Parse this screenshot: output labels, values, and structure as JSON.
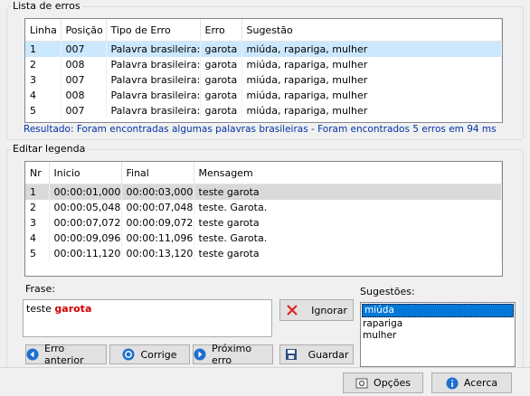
{
  "errors_group": {
    "title": "Lista de erros",
    "columns": [
      "Linha",
      "Posição",
      "Tipo de Erro",
      "Erro",
      "Sugestão"
    ],
    "rows": [
      [
        "1",
        "007",
        "Palavra brasileira:",
        "garota",
        "miúda, rapariga, mulher"
      ],
      [
        "2",
        "008",
        "Palavra brasileira:",
        "garota",
        "miúda, rapariga, mulher"
      ],
      [
        "3",
        "007",
        "Palavra brasileira:",
        "garota",
        "miúda, rapariga, mulher"
      ],
      [
        "4",
        "008",
        "Palavra brasileira:",
        "garota",
        "miúda, rapariga, mulher"
      ],
      [
        "5",
        "007",
        "Palavra brasileira:",
        "garota",
        "miúda, rapariga, mulher"
      ]
    ],
    "result": "Resultado: Foram encontradas algumas palavras brasileiras - Foram encontrados 5 erros em 94 ms"
  },
  "edit_group": {
    "title": "Editar legenda",
    "columns": [
      "Nr",
      "Inicio",
      "Final",
      "Mensagem"
    ],
    "rows": [
      [
        "1",
        "00:00:01,000",
        "00:00:03,000",
        "teste garota"
      ],
      [
        "2",
        "00:00:05,048",
        "00:00:07,048",
        "teste. Garota."
      ],
      [
        "3",
        "00:00:07,072",
        "00:00:09,072",
        "teste garota"
      ],
      [
        "4",
        "00:00:09,096",
        "00:00:11,096",
        "teste. Garota."
      ],
      [
        "5",
        "00:00:11,120",
        "00:00:13,120",
        "teste garota"
      ]
    ],
    "frase_label": "Frase:",
    "frase_text": "teste",
    "frase_error": "garota",
    "sugestoes_label": "Sugestões:",
    "sugestoes": [
      "miúda",
      "rapariga",
      "mulher"
    ],
    "ignore": "Ignorar",
    "prev": "Erro anterior",
    "fix": "Corrige",
    "next": "Próximo erro",
    "save": "Guardar"
  },
  "footer": {
    "options": "Opções",
    "about": "Acerca"
  }
}
